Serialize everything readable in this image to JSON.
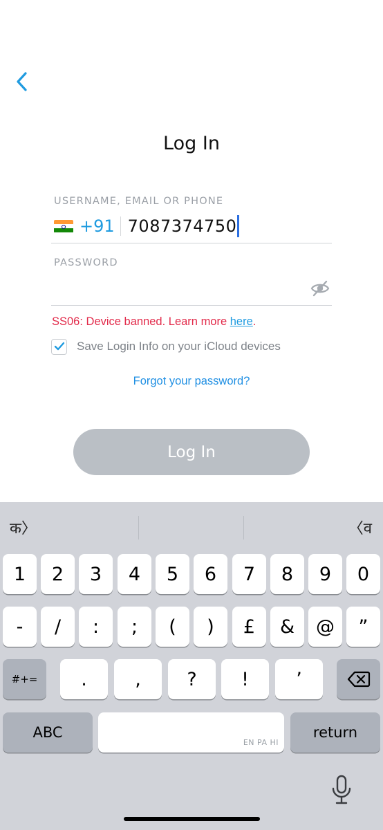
{
  "header": {
    "back_icon": "chevron-left-icon",
    "title": "Log In"
  },
  "form": {
    "username_label": "USERNAME, EMAIL OR PHONE",
    "country_flag": "india-flag-icon",
    "country_code": "+91",
    "phone_value": "7087374750",
    "password_label": "PASSWORD",
    "password_value": "",
    "eye_icon": "eye-slash-icon",
    "error_text": "SS06: Device banned. Learn more ",
    "error_link": "here",
    "error_tail": ".",
    "save_label": "Save Login Info on your iCloud devices",
    "save_checked": true,
    "forgot_label": "Forgot your password?",
    "login_button": "Log In"
  },
  "colors": {
    "accent": "#1f9be0",
    "error": "#e22a4a",
    "button_disabled": "#babfc5"
  },
  "keyboard": {
    "suggestions": {
      "left": "क〉",
      "middle": "",
      "right": "〈व"
    },
    "row1": [
      "1",
      "2",
      "3",
      "4",
      "5",
      "6",
      "7",
      "8",
      "9",
      "0"
    ],
    "row2": [
      "-",
      "/",
      ":",
      ";",
      "(",
      ")",
      "£",
      "&",
      "@",
      "”"
    ],
    "row3_left": "#+=",
    "row3": [
      ".",
      ",",
      "?",
      "!",
      "’"
    ],
    "backspace_icon": "backspace-icon",
    "abc": "ABC",
    "space_hint": "EN PA HI",
    "return": "return",
    "mic_icon": "microphone-icon"
  }
}
